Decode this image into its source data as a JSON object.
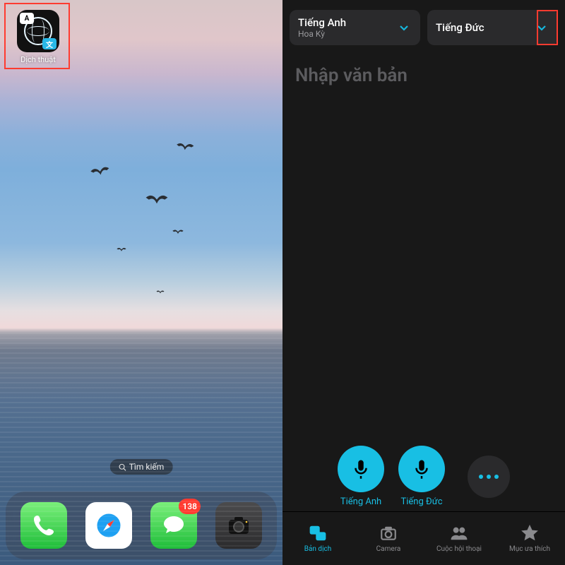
{
  "home": {
    "app": {
      "label": "Dịch thuật"
    },
    "search_label": "Tìm kiếm",
    "dock": {
      "badge": "138"
    }
  },
  "translate": {
    "from": {
      "name": "Tiếng Anh",
      "sub": "Hoa Kỳ"
    },
    "to": {
      "name": "Tiếng Đức"
    },
    "placeholder": "Nhập văn bản",
    "mic1_label": "Tiếng Anh",
    "mic2_label": "Tiếng Đức",
    "tabs": {
      "translate": "Bản dịch",
      "camera": "Camera",
      "conversation": "Cuộc hội thoại",
      "favorites": "Mục ưa thích"
    }
  }
}
